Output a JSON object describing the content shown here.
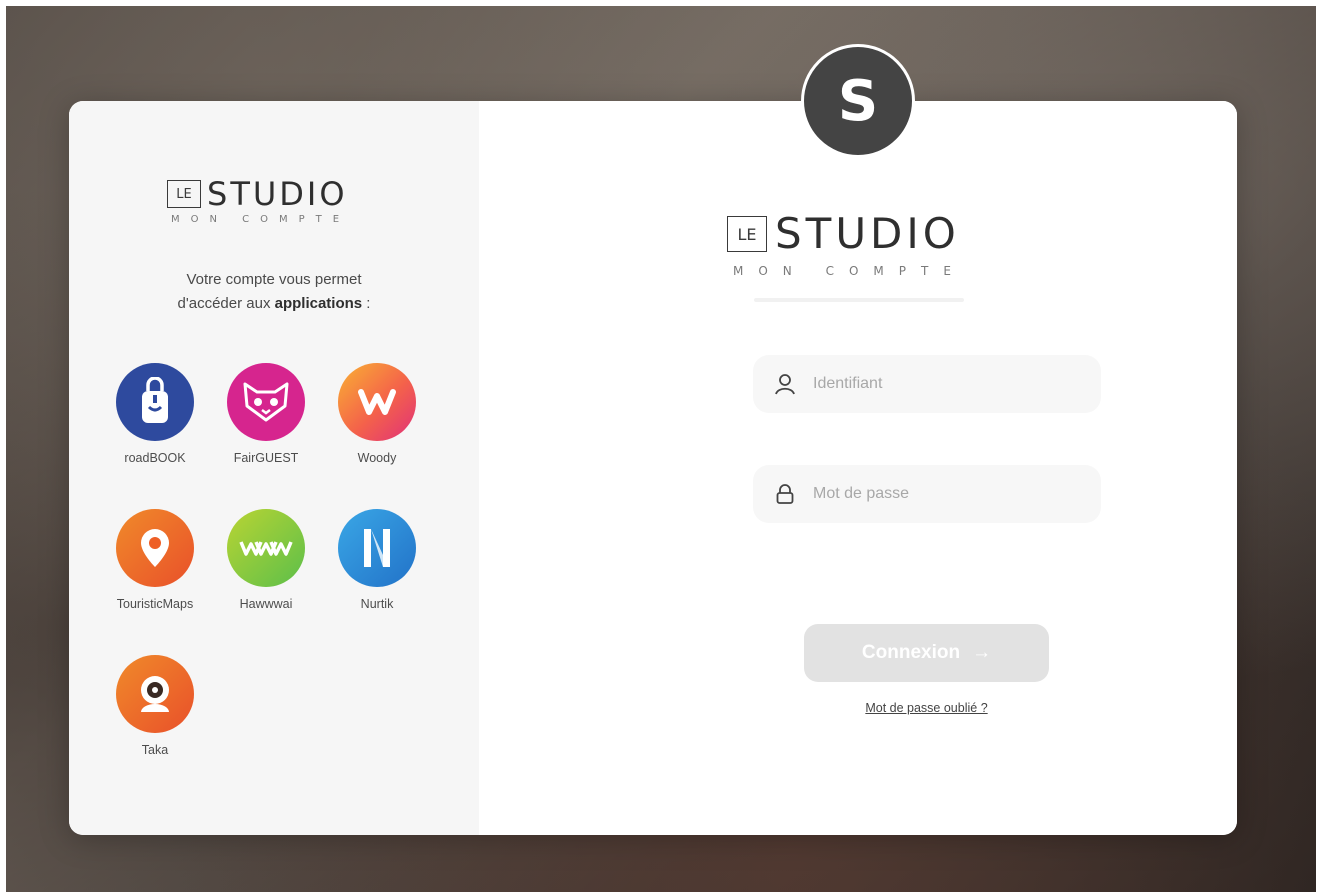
{
  "avatar": {
    "letter": "S"
  },
  "brand": {
    "le": "LE",
    "name": "STUDIO",
    "subtitle": "MON COMPTE"
  },
  "left_panel": {
    "intro_line1": "Votre compte vous permet",
    "intro_line2_prefix": "d'accéder aux ",
    "intro_line2_bold": "applications",
    "intro_line2_suffix": " :",
    "apps": [
      {
        "name": "roadBOOK",
        "icon": "roadbook-icon",
        "color": "#2e4a9e"
      },
      {
        "name": "FairGUEST",
        "icon": "fairguest-icon",
        "color": "#d6258e"
      },
      {
        "name": "Woody",
        "icon": "woody-icon",
        "color": "#f4624a"
      },
      {
        "name": "TouristicMaps",
        "icon": "touristicmaps-icon",
        "color": "#ee5f26"
      },
      {
        "name": "Hawwwai",
        "icon": "hawwwai-icon",
        "color": "#7fc73b"
      },
      {
        "name": "Nurtik",
        "icon": "nurtik-icon",
        "color": "#2b8fd6"
      },
      {
        "name": "Taka",
        "icon": "taka-icon",
        "color": "#ee6a22"
      }
    ]
  },
  "login": {
    "username_placeholder": "Identifiant",
    "password_placeholder": "Mot de passe",
    "submit_label": "Connexion",
    "submit_arrow": "→",
    "forgot_link": "Mot de passe oublié ?"
  }
}
